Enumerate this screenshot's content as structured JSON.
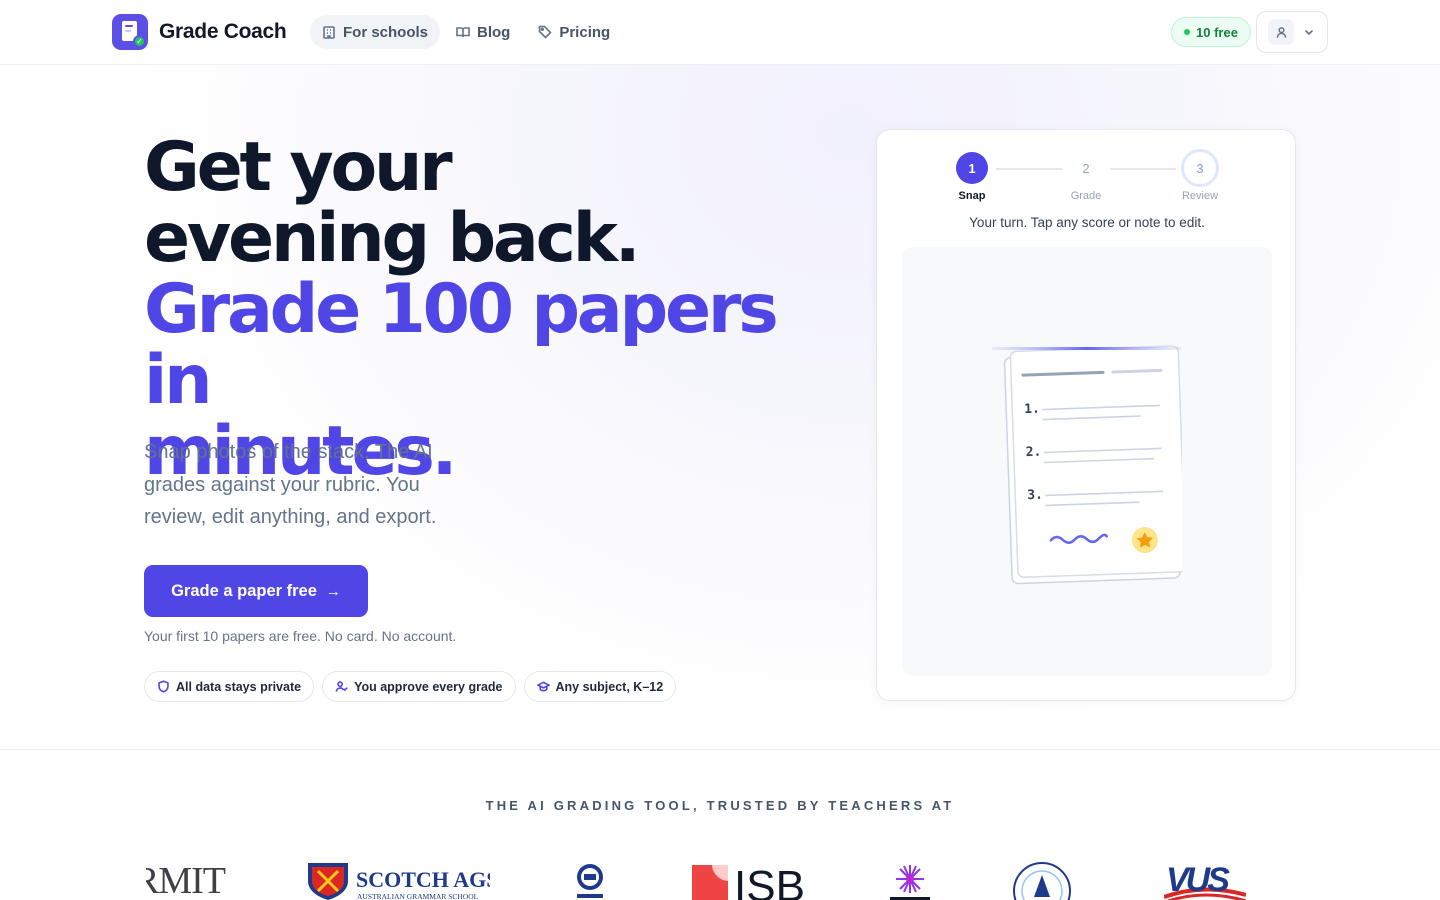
{
  "header": {
    "brand": "Grade Coach",
    "nav": [
      {
        "label": "For schools",
        "icon": "building-icon"
      },
      {
        "label": "Blog",
        "icon": "book-open-icon"
      },
      {
        "label": "Pricing",
        "icon": "tag-icon"
      }
    ],
    "credits": "10 free"
  },
  "hero": {
    "headline_line1": "Get your",
    "headline_line2": "evening back.",
    "accent_line1": "Grade 100 papers in",
    "accent_line2": "minutes.",
    "subcopy": "Snap photos of the stack. The AI grades against your rubric. You review, edit anything, and export.",
    "cta_label": "Grade a paper free",
    "fine_print": "Your first 10 papers are free. No card. No account.",
    "badges": [
      {
        "label": "All data stays private",
        "icon": "shield-icon"
      },
      {
        "label": "You approve every grade",
        "icon": "user-check-icon"
      },
      {
        "label": "Any subject, K–12",
        "icon": "graduation-cap-icon"
      }
    ]
  },
  "demo": {
    "steps": [
      {
        "num": "1",
        "label": "Snap"
      },
      {
        "num": "2",
        "label": "Grade"
      },
      {
        "num": "3",
        "label": "Review"
      }
    ],
    "instruction": "Your turn. Tap any score or note to edit.",
    "paper_items": [
      "1.",
      "2.",
      "3."
    ]
  },
  "trust": {
    "heading": "THE AI GRADING TOOL, TRUSTED BY TEACHERS AT",
    "logos": {
      "rmit": "RMIT",
      "scotch": "SCOTCH AGS",
      "scotch_sub": "AUSTRALIAN GRAMMAR SCHOOL",
      "isb": "ISB",
      "vus": "VUS"
    }
  },
  "colors": {
    "accent": "#4f46e5",
    "brand_mark": "#5b4fe6",
    "success": "#22c55e",
    "headline": "#0f172a",
    "muted": "#64748b"
  }
}
